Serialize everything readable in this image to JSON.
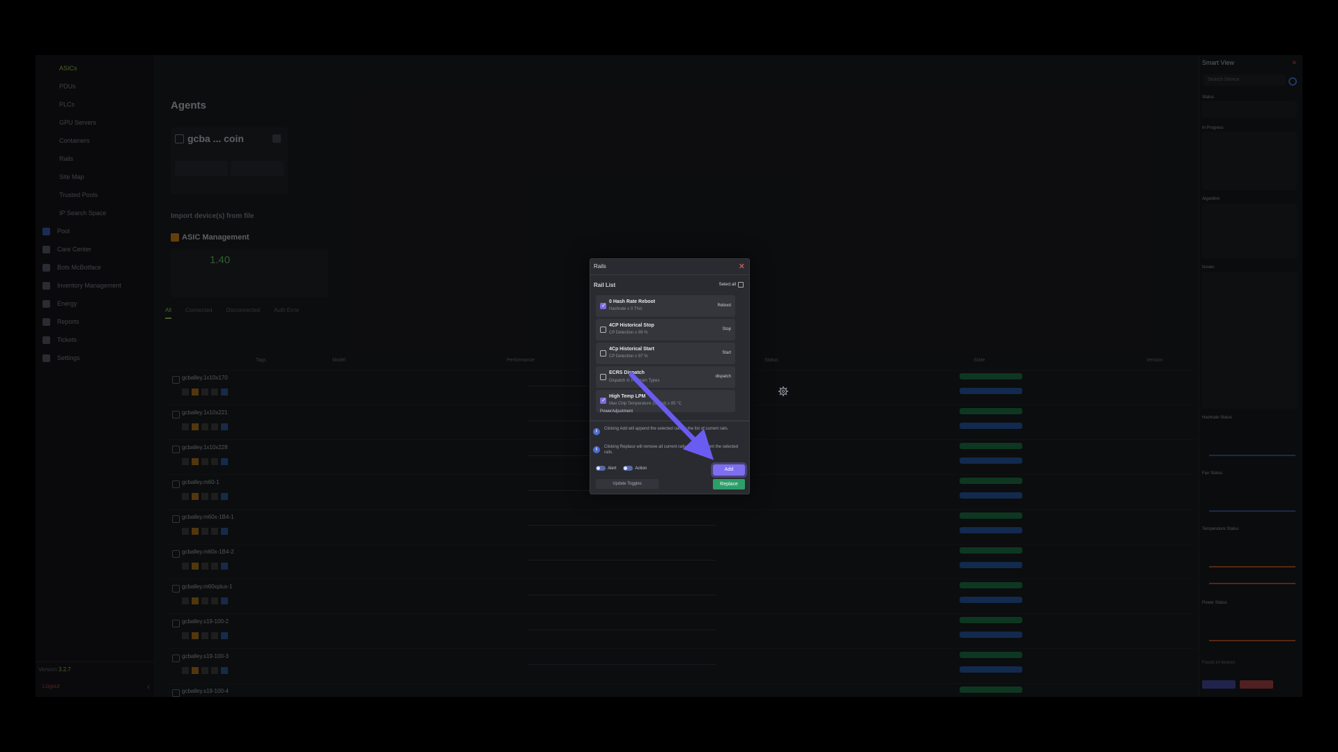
{
  "sidebar": {
    "items": [
      {
        "label": "ASICs",
        "active": true
      },
      {
        "label": "PDUs"
      },
      {
        "label": "PLCs"
      },
      {
        "label": "GPU Servers"
      },
      {
        "label": "Containers"
      },
      {
        "label": "Rails"
      },
      {
        "label": "Site Map"
      },
      {
        "label": "Trusted Pools"
      },
      {
        "label": "IP Search Space"
      },
      {
        "label": "Pool"
      },
      {
        "label": "Care Center"
      },
      {
        "label": "Bots McBotface"
      },
      {
        "label": "Inventory Management"
      },
      {
        "label": "Energy"
      },
      {
        "label": "Reports"
      },
      {
        "label": "Tickets"
      },
      {
        "label": "Settings"
      }
    ],
    "version_prefix": "Version",
    "version_value": "3.2.7",
    "logout": "Logout"
  },
  "main": {
    "title": "Agents",
    "agent_name": "gcba ... coin",
    "import_label": "Import device(s) from file",
    "section_title": "ASIC Management",
    "big_stat": "1.40",
    "tabs": [
      "All",
      "Connected",
      "Disconnected",
      "Auth Error"
    ],
    "columns": [
      "Tags",
      "Model",
      "Performance",
      "Status",
      "State",
      "Version"
    ],
    "rows": [
      {
        "name": "gcballey.1x10x170"
      },
      {
        "name": "gcballey.1x10x221"
      },
      {
        "name": "gcballey.1x10x228"
      },
      {
        "name": "gcballey.m60-1"
      },
      {
        "name": "gcballey.m60x-1B4-1"
      },
      {
        "name": "gcballey.m60x-1B4-2"
      },
      {
        "name": "gcballey.m60xplus-1"
      },
      {
        "name": "gcballey.s19-100-2"
      },
      {
        "name": "gcballey.s19-100-3"
      },
      {
        "name": "gcballey.s19-100-4"
      }
    ]
  },
  "smart_view": {
    "title": "Smart View",
    "search_placeholder": "Search Device",
    "status": "Status",
    "in_progress": "In Progress",
    "algorithm": "Algorithm",
    "issues": "Issues",
    "hashrate_status": "Hashrate Status",
    "fan_status": "Fan Status",
    "temperature_status": "Temperature Status",
    "power_status": "Power Status",
    "found": "Found 14 devices"
  },
  "modal": {
    "title": "Rails",
    "list_title": "Rail List",
    "select_all": "Select all",
    "rails": [
      {
        "name": "0 Hash Rate Reboot",
        "desc": "Hashrate ≤ 0 Th/s",
        "action": "Reboot",
        "checked": true
      },
      {
        "name": "4CP Historical Stop",
        "desc": "CP Detection ≥ 99 %",
        "action": "Stop",
        "checked": false
      },
      {
        "name": "4Cp Historical Start",
        "desc": "CP Detection ≤ 97 %",
        "action": "Start",
        "checked": false
      },
      {
        "name": "ECRS Dispatch",
        "desc": "Dispatch ∈ Program Types",
        "action": "dispatch",
        "checked": false
      },
      {
        "name": "High Temp LPM",
        "desc": "Max Chip Temperature (Outlet) ≥ 85 °C",
        "action": "",
        "extra": "PowerAdjustment",
        "checked": true
      }
    ],
    "note_add": "Clicking Add will append the selected rails to the list of current rails.",
    "note_replace": "Clicking Replace will remove all current rails and implement the selected rails.",
    "alert_label": "Alert",
    "action_label": "Action",
    "update_toggles": "Update Toggles",
    "add": "Add",
    "replace": "Replace"
  },
  "colors": {
    "accent_purple": "#7d6ff0",
    "replace_green": "#2c9e6a",
    "arrow": "#6a5cf0"
  }
}
